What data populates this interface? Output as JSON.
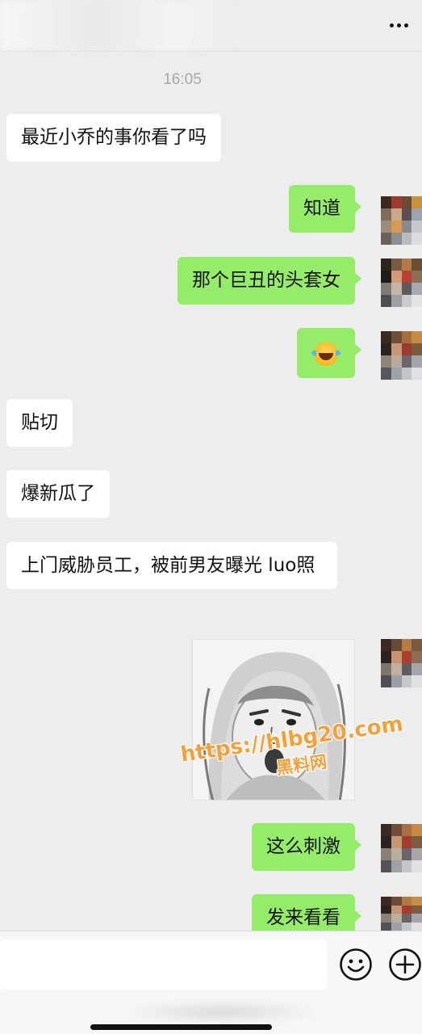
{
  "header": {
    "more_icon": "more-dots-icon"
  },
  "timestamp": "16:05",
  "messages": [
    {
      "side": "left",
      "text": "最近小乔的事你看了吗"
    },
    {
      "side": "right",
      "text": "知道"
    },
    {
      "side": "right",
      "text": "那个巨丑的头套女"
    },
    {
      "side": "right",
      "emoji": "face-with-tears-of-joy"
    },
    {
      "side": "left",
      "text": "贴切"
    },
    {
      "side": "left",
      "text": "爆新瓜了"
    },
    {
      "side": "left",
      "text": "上门威胁员工，被前男友曝光 luo照"
    },
    {
      "side": "right",
      "sticker": "shocked-face-meme"
    },
    {
      "side": "right",
      "text": "这么刺激"
    },
    {
      "side": "right",
      "text": "发来看看"
    }
  ],
  "watermark": {
    "url": "https://hlbg20.com",
    "site": "黑料网"
  },
  "input_bar": {
    "emoji_icon": "smiley-icon",
    "plus_icon": "plus-icon"
  },
  "colors": {
    "background": "#ededed",
    "bubble_self": "#95ec69",
    "bubble_other": "#ffffff",
    "timestamp": "#a8a8a8",
    "watermark": "#f2a13a"
  }
}
